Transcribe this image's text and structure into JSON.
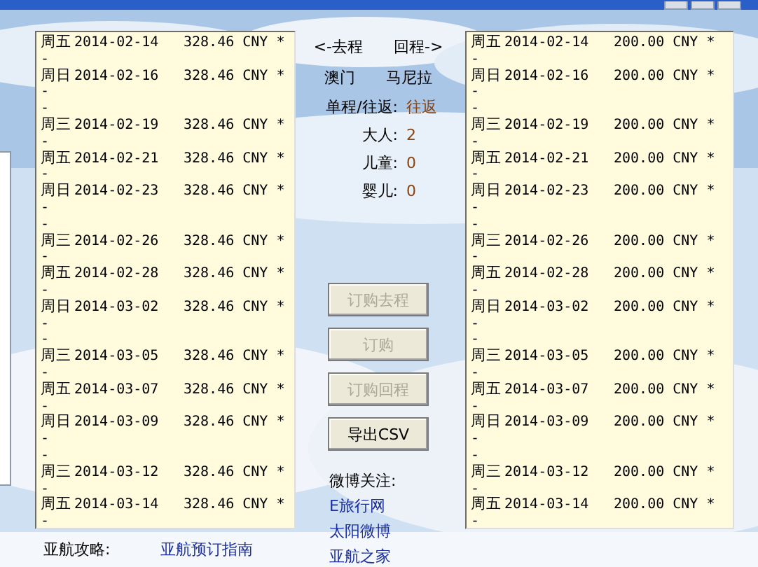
{
  "outbound_list": {
    "rows": [
      {
        "day": "周五",
        "date": "2014-02-14",
        "price": "328.46 CNY *",
        "dashes": [
          "-"
        ]
      },
      {
        "day": "周日",
        "date": "2014-02-16",
        "price": "328.46 CNY *",
        "dashes": [
          "-",
          "-"
        ]
      },
      {
        "day": "周三",
        "date": "2014-02-19",
        "price": "328.46 CNY *",
        "dashes": [
          "-"
        ]
      },
      {
        "day": "周五",
        "date": "2014-02-21",
        "price": "328.46 CNY *",
        "dashes": [
          "-"
        ]
      },
      {
        "day": "周日",
        "date": "2014-02-23",
        "price": "328.46 CNY *",
        "dashes": [
          "-",
          "-"
        ]
      },
      {
        "day": "周三",
        "date": "2014-02-26",
        "price": "328.46 CNY *",
        "dashes": [
          "-"
        ]
      },
      {
        "day": "周五",
        "date": "2014-02-28",
        "price": "328.46 CNY *",
        "dashes": [
          "-"
        ]
      },
      {
        "day": "周日",
        "date": "2014-03-02",
        "price": "328.46 CNY *",
        "dashes": [
          "-",
          "-"
        ]
      },
      {
        "day": "周三",
        "date": "2014-03-05",
        "price": "328.46 CNY *",
        "dashes": [
          "-"
        ]
      },
      {
        "day": "周五",
        "date": "2014-03-07",
        "price": "328.46 CNY *",
        "dashes": [
          "-"
        ]
      },
      {
        "day": "周日",
        "date": "2014-03-09",
        "price": "328.46 CNY *",
        "dashes": [
          "-",
          "-"
        ]
      },
      {
        "day": "周三",
        "date": "2014-03-12",
        "price": "328.46 CNY *",
        "dashes": [
          "-"
        ]
      },
      {
        "day": "周五",
        "date": "2014-03-14",
        "price": "328.46 CNY *",
        "dashes": [
          "-"
        ]
      }
    ]
  },
  "summary": {
    "outbound_header": "<-去程",
    "return_header": "回程->",
    "origin": "澳门",
    "destination": "马尼拉",
    "fields": [
      {
        "label": "单程/往返:",
        "value": "往返"
      },
      {
        "label": "大人:",
        "value": "2"
      },
      {
        "label": "儿童:",
        "value": "0"
      },
      {
        "label": "婴儿:",
        "value": "0"
      }
    ]
  },
  "buttons": [
    {
      "label": "订购去程",
      "disabled": true
    },
    {
      "label": "订购",
      "disabled": true
    },
    {
      "label": "订购回程",
      "disabled": true
    },
    {
      "label": "导出CSV",
      "disabled": false
    }
  ],
  "weibo": {
    "label": "微博关注:",
    "links": [
      "E旅行网",
      "太阳微博",
      "亚航之家"
    ]
  },
  "return_list": {
    "rows": [
      {
        "day": "周五",
        "date": "2014-02-14",
        "price": "200.00 CNY *",
        "dashes": [
          "-"
        ]
      },
      {
        "day": "周日",
        "date": "2014-02-16",
        "price": "200.00 CNY *",
        "dashes": [
          "-",
          "-"
        ]
      },
      {
        "day": "周三",
        "date": "2014-02-19",
        "price": "200.00 CNY *",
        "dashes": [
          "-"
        ]
      },
      {
        "day": "周五",
        "date": "2014-02-21",
        "price": "200.00 CNY *",
        "dashes": [
          "-"
        ]
      },
      {
        "day": "周日",
        "date": "2014-02-23",
        "price": "200.00 CNY *",
        "dashes": [
          "-",
          "-"
        ]
      },
      {
        "day": "周三",
        "date": "2014-02-26",
        "price": "200.00 CNY *",
        "dashes": [
          "-"
        ]
      },
      {
        "day": "周五",
        "date": "2014-02-28",
        "price": "200.00 CNY *",
        "dashes": [
          "-"
        ]
      },
      {
        "day": "周日",
        "date": "2014-03-02",
        "price": "200.00 CNY *",
        "dashes": [
          "-",
          "-"
        ]
      },
      {
        "day": "周三",
        "date": "2014-03-05",
        "price": "200.00 CNY *",
        "dashes": [
          "-"
        ]
      },
      {
        "day": "周五",
        "date": "2014-03-07",
        "price": "200.00 CNY *",
        "dashes": [
          "-"
        ]
      },
      {
        "day": "周日",
        "date": "2014-03-09",
        "price": "200.00 CNY *",
        "dashes": [
          "-",
          "-"
        ]
      },
      {
        "day": "周三",
        "date": "2014-03-12",
        "price": "200.00 CNY *",
        "dashes": [
          "-"
        ]
      },
      {
        "day": "周五",
        "date": "2014-03-14",
        "price": "200.00 CNY *",
        "dashes": [
          "-"
        ]
      }
    ]
  },
  "footer": {
    "label": "亚航攻略:",
    "link": "亚航预订指南"
  }
}
